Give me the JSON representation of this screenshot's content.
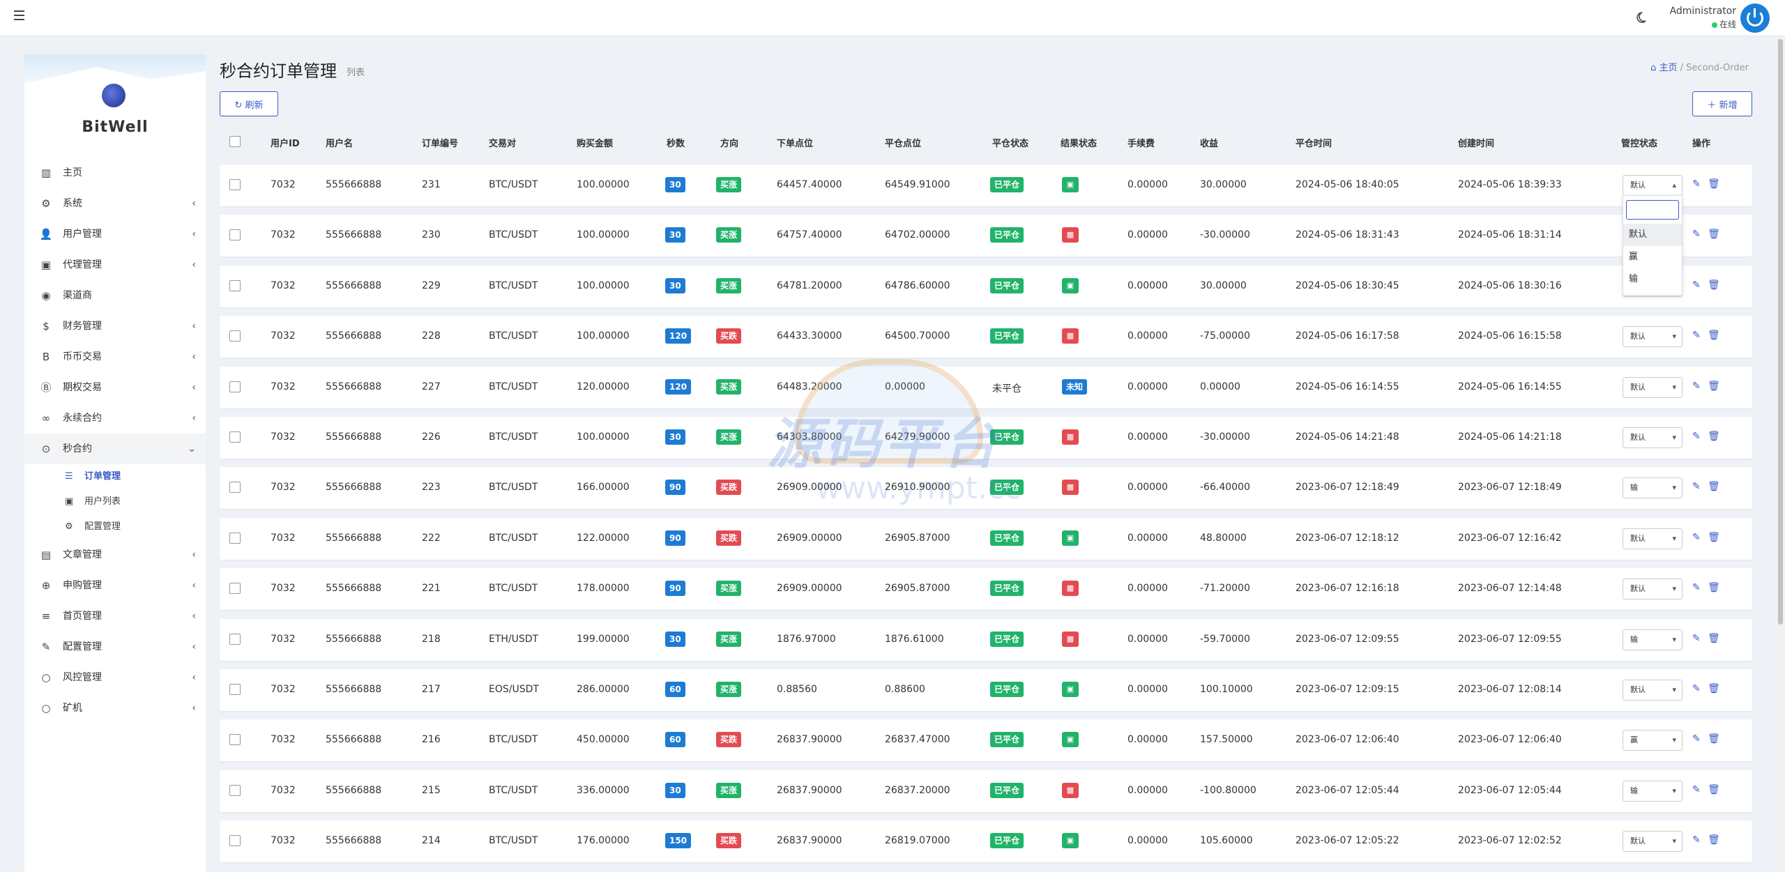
{
  "topbar": {
    "admin_name": "Administrator",
    "admin_status": "在线"
  },
  "sidebar": {
    "logo_text": "BitWell",
    "items": [
      {
        "label": "主页",
        "icon": "chart-icon",
        "has_children": false
      },
      {
        "label": "系统",
        "icon": "gear-icon",
        "has_children": true
      },
      {
        "label": "用户管理",
        "icon": "user-icon",
        "has_children": true
      },
      {
        "label": "代理管理",
        "icon": "id-card-icon",
        "has_children": true
      },
      {
        "label": "渠道商",
        "icon": "user-circle-icon",
        "has_children": false
      },
      {
        "label": "财务管理",
        "icon": "dollar-icon",
        "has_children": true
      },
      {
        "label": "币币交易",
        "icon": "bitcoin-icon",
        "has_children": true
      },
      {
        "label": "期权交易",
        "icon": "bitcoin-circle-icon",
        "has_children": true
      },
      {
        "label": "永续合约",
        "icon": "link-icon",
        "has_children": true
      },
      {
        "label": "秒合约",
        "icon": "dot-circle-icon",
        "has_children": true,
        "open": true,
        "children": [
          {
            "label": "订单管理",
            "icon": "list-icon",
            "active": true
          },
          {
            "label": "用户列表",
            "icon": "user-square-icon",
            "active": false
          },
          {
            "label": "配置管理",
            "icon": "gear-icon",
            "active": false
          }
        ]
      },
      {
        "label": "文章管理",
        "icon": "newspaper-icon",
        "has_children": true
      },
      {
        "label": "申购管理",
        "icon": "support-icon",
        "has_children": true
      },
      {
        "label": "首页管理",
        "icon": "lines-icon",
        "has_children": true
      },
      {
        "label": "配置管理",
        "icon": "wrench-icon",
        "has_children": true
      },
      {
        "label": "风控管理",
        "icon": "circle-icon",
        "has_children": true
      },
      {
        "label": "矿机",
        "icon": "circle-icon",
        "has_children": true
      }
    ]
  },
  "main": {
    "title": "秒合约订单管理",
    "subtitle": "列表",
    "breadcrumb_home": "主页",
    "breadcrumb_current": "Second-Order",
    "refresh_label": "刷新",
    "add_label": "新增"
  },
  "table": {
    "headers": [
      "用户ID",
      "用户名",
      "订单编号",
      "交易对",
      "购买金额",
      "秒数",
      "方向",
      "下单点位",
      "平仓点位",
      "平仓状态",
      "结果状态",
      "手续费",
      "收益",
      "平仓时间",
      "创建时间",
      "管控状态",
      "操作"
    ],
    "rows": [
      {
        "uid": "7032",
        "username": "555666888",
        "order_no": "231",
        "pair": "BTC/USDT",
        "amount": "100.00000",
        "seconds": "30",
        "direction": "买涨",
        "open_price": "64457.40000",
        "close_price": "64549.91000",
        "close_status": "已平仓",
        "result": "win",
        "fee": "0.00000",
        "profit": "30.00000",
        "close_time": "2024-05-06 18:40:05",
        "create_time": "2024-05-06 18:39:33",
        "control": "默认"
      },
      {
        "uid": "7032",
        "username": "555666888",
        "order_no": "230",
        "pair": "BTC/USDT",
        "amount": "100.00000",
        "seconds": "30",
        "direction": "买涨",
        "open_price": "64757.40000",
        "close_price": "64702.00000",
        "close_status": "已平仓",
        "result": "lose",
        "fee": "0.00000",
        "profit": "-30.00000",
        "close_time": "2024-05-06 18:31:43",
        "create_time": "2024-05-06 18:31:14",
        "control": ""
      },
      {
        "uid": "7032",
        "username": "555666888",
        "order_no": "229",
        "pair": "BTC/USDT",
        "amount": "100.00000",
        "seconds": "30",
        "direction": "买涨",
        "open_price": "64781.20000",
        "close_price": "64786.60000",
        "close_status": "已平仓",
        "result": "win",
        "fee": "0.00000",
        "profit": "30.00000",
        "close_time": "2024-05-06 18:30:45",
        "create_time": "2024-05-06 18:30:16",
        "control": ""
      },
      {
        "uid": "7032",
        "username": "555666888",
        "order_no": "228",
        "pair": "BTC/USDT",
        "amount": "100.00000",
        "seconds": "120",
        "direction": "买跌",
        "open_price": "64433.30000",
        "close_price": "64500.70000",
        "close_status": "已平仓",
        "result": "lose",
        "fee": "0.00000",
        "profit": "-75.00000",
        "close_time": "2024-05-06 16:17:58",
        "create_time": "2024-05-06 16:15:58",
        "control": "默认"
      },
      {
        "uid": "7032",
        "username": "555666888",
        "order_no": "227",
        "pair": "BTC/USDT",
        "amount": "120.00000",
        "seconds": "120",
        "direction": "买涨",
        "open_price": "64483.20000",
        "close_price": "0.00000",
        "close_status": "未平仓",
        "result": "unknown",
        "fee": "0.00000",
        "profit": "0.00000",
        "close_time": "2024-05-06 16:14:55",
        "create_time": "2024-05-06 16:14:55",
        "control": "默认"
      },
      {
        "uid": "7032",
        "username": "555666888",
        "order_no": "226",
        "pair": "BTC/USDT",
        "amount": "100.00000",
        "seconds": "30",
        "direction": "买涨",
        "open_price": "64303.80000",
        "close_price": "64279.90000",
        "close_status": "已平仓",
        "result": "lose",
        "fee": "0.00000",
        "profit": "-30.00000",
        "close_time": "2024-05-06 14:21:48",
        "create_time": "2024-05-06 14:21:18",
        "control": "默认"
      },
      {
        "uid": "7032",
        "username": "555666888",
        "order_no": "223",
        "pair": "BTC/USDT",
        "amount": "166.00000",
        "seconds": "90",
        "direction": "买跌",
        "open_price": "26909.00000",
        "close_price": "26910.90000",
        "close_status": "已平仓",
        "result": "lose",
        "fee": "0.00000",
        "profit": "-66.40000",
        "close_time": "2023-06-07 12:18:49",
        "create_time": "2023-06-07 12:18:49",
        "control": "输"
      },
      {
        "uid": "7032",
        "username": "555666888",
        "order_no": "222",
        "pair": "BTC/USDT",
        "amount": "122.00000",
        "seconds": "90",
        "direction": "买跌",
        "open_price": "26909.00000",
        "close_price": "26905.87000",
        "close_status": "已平仓",
        "result": "win",
        "fee": "0.00000",
        "profit": "48.80000",
        "close_time": "2023-06-07 12:18:12",
        "create_time": "2023-06-07 12:16:42",
        "control": "默认"
      },
      {
        "uid": "7032",
        "username": "555666888",
        "order_no": "221",
        "pair": "BTC/USDT",
        "amount": "178.00000",
        "seconds": "90",
        "direction": "买涨",
        "open_price": "26909.00000",
        "close_price": "26905.87000",
        "close_status": "已平仓",
        "result": "lose",
        "fee": "0.00000",
        "profit": "-71.20000",
        "close_time": "2023-06-07 12:16:18",
        "create_time": "2023-06-07 12:14:48",
        "control": "默认"
      },
      {
        "uid": "7032",
        "username": "555666888",
        "order_no": "218",
        "pair": "ETH/USDT",
        "amount": "199.00000",
        "seconds": "30",
        "direction": "买涨",
        "open_price": "1876.97000",
        "close_price": "1876.61000",
        "close_status": "已平仓",
        "result": "lose",
        "fee": "0.00000",
        "profit": "-59.70000",
        "close_time": "2023-06-07 12:09:55",
        "create_time": "2023-06-07 12:09:55",
        "control": "输"
      },
      {
        "uid": "7032",
        "username": "555666888",
        "order_no": "217",
        "pair": "EOS/USDT",
        "amount": "286.00000",
        "seconds": "60",
        "direction": "买涨",
        "open_price": "0.88560",
        "close_price": "0.88600",
        "close_status": "已平仓",
        "result": "win",
        "fee": "0.00000",
        "profit": "100.10000",
        "close_time": "2023-06-07 12:09:15",
        "create_time": "2023-06-07 12:08:14",
        "control": "默认"
      },
      {
        "uid": "7032",
        "username": "555666888",
        "order_no": "216",
        "pair": "BTC/USDT",
        "amount": "450.00000",
        "seconds": "60",
        "direction": "买跌",
        "open_price": "26837.90000",
        "close_price": "26837.47000",
        "close_status": "已平仓",
        "result": "win",
        "fee": "0.00000",
        "profit": "157.50000",
        "close_time": "2023-06-07 12:06:40",
        "create_time": "2023-06-07 12:06:40",
        "control": "赢"
      },
      {
        "uid": "7032",
        "username": "555666888",
        "order_no": "215",
        "pair": "BTC/USDT",
        "amount": "336.00000",
        "seconds": "30",
        "direction": "买涨",
        "open_price": "26837.90000",
        "close_price": "26837.20000",
        "close_status": "已平仓",
        "result": "lose",
        "fee": "0.00000",
        "profit": "-100.80000",
        "close_time": "2023-06-07 12:05:44",
        "create_time": "2023-06-07 12:05:44",
        "control": "输"
      },
      {
        "uid": "7032",
        "username": "555666888",
        "order_no": "214",
        "pair": "BTC/USDT",
        "amount": "176.00000",
        "seconds": "150",
        "direction": "买跌",
        "open_price": "26837.90000",
        "close_price": "26819.07000",
        "close_status": "已平仓",
        "result": "win",
        "fee": "0.00000",
        "profit": "105.60000",
        "close_time": "2023-06-07 12:05:22",
        "create_time": "2023-06-07 12:02:52",
        "control": "默认"
      }
    ]
  },
  "dropdown": {
    "search_value": "",
    "options": [
      "默认",
      "赢",
      "输"
    ],
    "selected": "默认"
  },
  "watermark": {
    "text": "源码平台",
    "url": "www.ympt.cc"
  },
  "colors": {
    "primary": "#3c5bc6",
    "badge_blue": "#1e7bd4",
    "badge_green": "#21b36a",
    "badge_red": "#e34b52"
  }
}
